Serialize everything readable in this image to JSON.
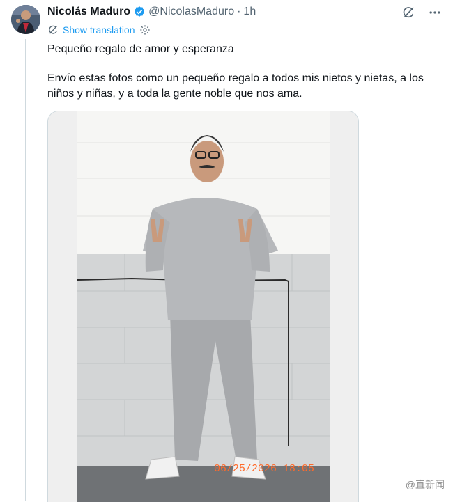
{
  "post": {
    "author_name": "Nicolás Maduro",
    "handle": "@NicolasMaduro",
    "separator": "·",
    "time": "1h",
    "translate_label": "Show translation",
    "line1": "Pequeño regalo de amor y esperanza",
    "line2": "Envío estas fotos como un pequeño regalo a todos mis nietos y nietas, a los niños y niñas, y a toda la gente noble que nos ama."
  },
  "photo": {
    "timestamp": "06/25/2026 18:05"
  },
  "watermark": {
    "text": "@直新闻"
  },
  "icons": {
    "verified": "verified-badge-icon",
    "grok": "grok-icon",
    "more": "more-icon",
    "translate": "translate-icon",
    "settings": "settings-gear-icon"
  },
  "colors": {
    "accent": "#1d9bf0",
    "secondary_text": "#536471",
    "timestamp": "#ff6a2a"
  }
}
